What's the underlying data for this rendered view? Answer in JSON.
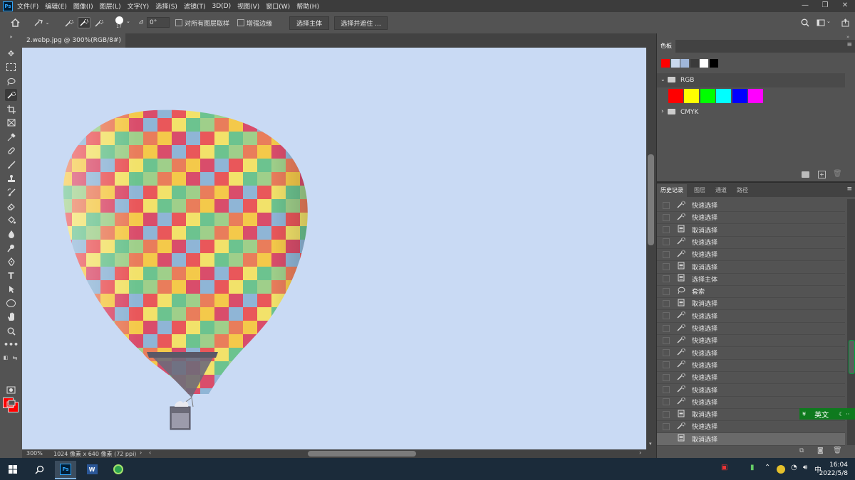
{
  "app": {
    "logo": "Ps"
  },
  "menu": [
    "文件(F)",
    "编辑(E)",
    "图像(I)",
    "图层(L)",
    "文字(Y)",
    "选择(S)",
    "滤镜(T)",
    "3D(D)",
    "视图(V)",
    "窗口(W)",
    "帮助(H)"
  ],
  "window_controls": {
    "minimize": "—",
    "restore": "❐",
    "close": "✕"
  },
  "options": {
    "brush_size": "17",
    "angle": "0°",
    "sample_all_layers": "对所有图层取样",
    "enhance_edge": "增强边缘",
    "select_subject": "选择主体",
    "select_and_mask": "选择并遮住 ..."
  },
  "document": {
    "tab_title": "2.webp.jpg @ 300%(RGB/8#) *",
    "tab_close": "×"
  },
  "status": {
    "zoom": "300%",
    "dimensions": "1024 像素 x 640 像素 (72 ppi)"
  },
  "colors": {
    "foreground": "#ff0000",
    "background": "#ff0000",
    "sky": "#c9daf4"
  },
  "swatches_panel": {
    "title": "色板",
    "recent": [
      "#ff0000",
      "#c8d8ee",
      "#9fb6d9",
      "#3a3a3a",
      "#ffffff",
      "#000000"
    ],
    "groups": [
      {
        "name": "RGB",
        "expanded": true,
        "colors": [
          "#ff0000",
          "#ffff00",
          "#00ff00",
          "#00ffff",
          "#0000ff",
          "#ff00ff"
        ]
      },
      {
        "name": "CMYK",
        "expanded": false
      }
    ]
  },
  "history_panel": {
    "tabs": [
      "历史记录",
      "图层",
      "通道",
      "路径"
    ],
    "items": [
      {
        "icon": "quick-select",
        "label": "快速选择"
      },
      {
        "icon": "quick-select",
        "label": "快速选择"
      },
      {
        "icon": "document",
        "label": "取消选择"
      },
      {
        "icon": "quick-select",
        "label": "快速选择"
      },
      {
        "icon": "quick-select",
        "label": "快速选择"
      },
      {
        "icon": "document",
        "label": "取消选择"
      },
      {
        "icon": "document",
        "label": "选择主体"
      },
      {
        "icon": "lasso",
        "label": "套索"
      },
      {
        "icon": "document",
        "label": "取消选择"
      },
      {
        "icon": "quick-select",
        "label": "快速选择"
      },
      {
        "icon": "quick-select",
        "label": "快速选择"
      },
      {
        "icon": "quick-select",
        "label": "快速选择"
      },
      {
        "icon": "quick-select",
        "label": "快速选择"
      },
      {
        "icon": "quick-select",
        "label": "快速选择"
      },
      {
        "icon": "quick-select",
        "label": "快速选择"
      },
      {
        "icon": "quick-select",
        "label": "快速选择"
      },
      {
        "icon": "quick-select",
        "label": "快速选择"
      },
      {
        "icon": "document",
        "label": "取消选择"
      },
      {
        "icon": "quick-select",
        "label": "快速选择"
      },
      {
        "icon": "document",
        "label": "取消选择"
      }
    ],
    "selected_index": 19
  },
  "ime": {
    "mode": "英文"
  },
  "taskbar": {
    "time": "16:04",
    "date": "2022/5/8"
  }
}
